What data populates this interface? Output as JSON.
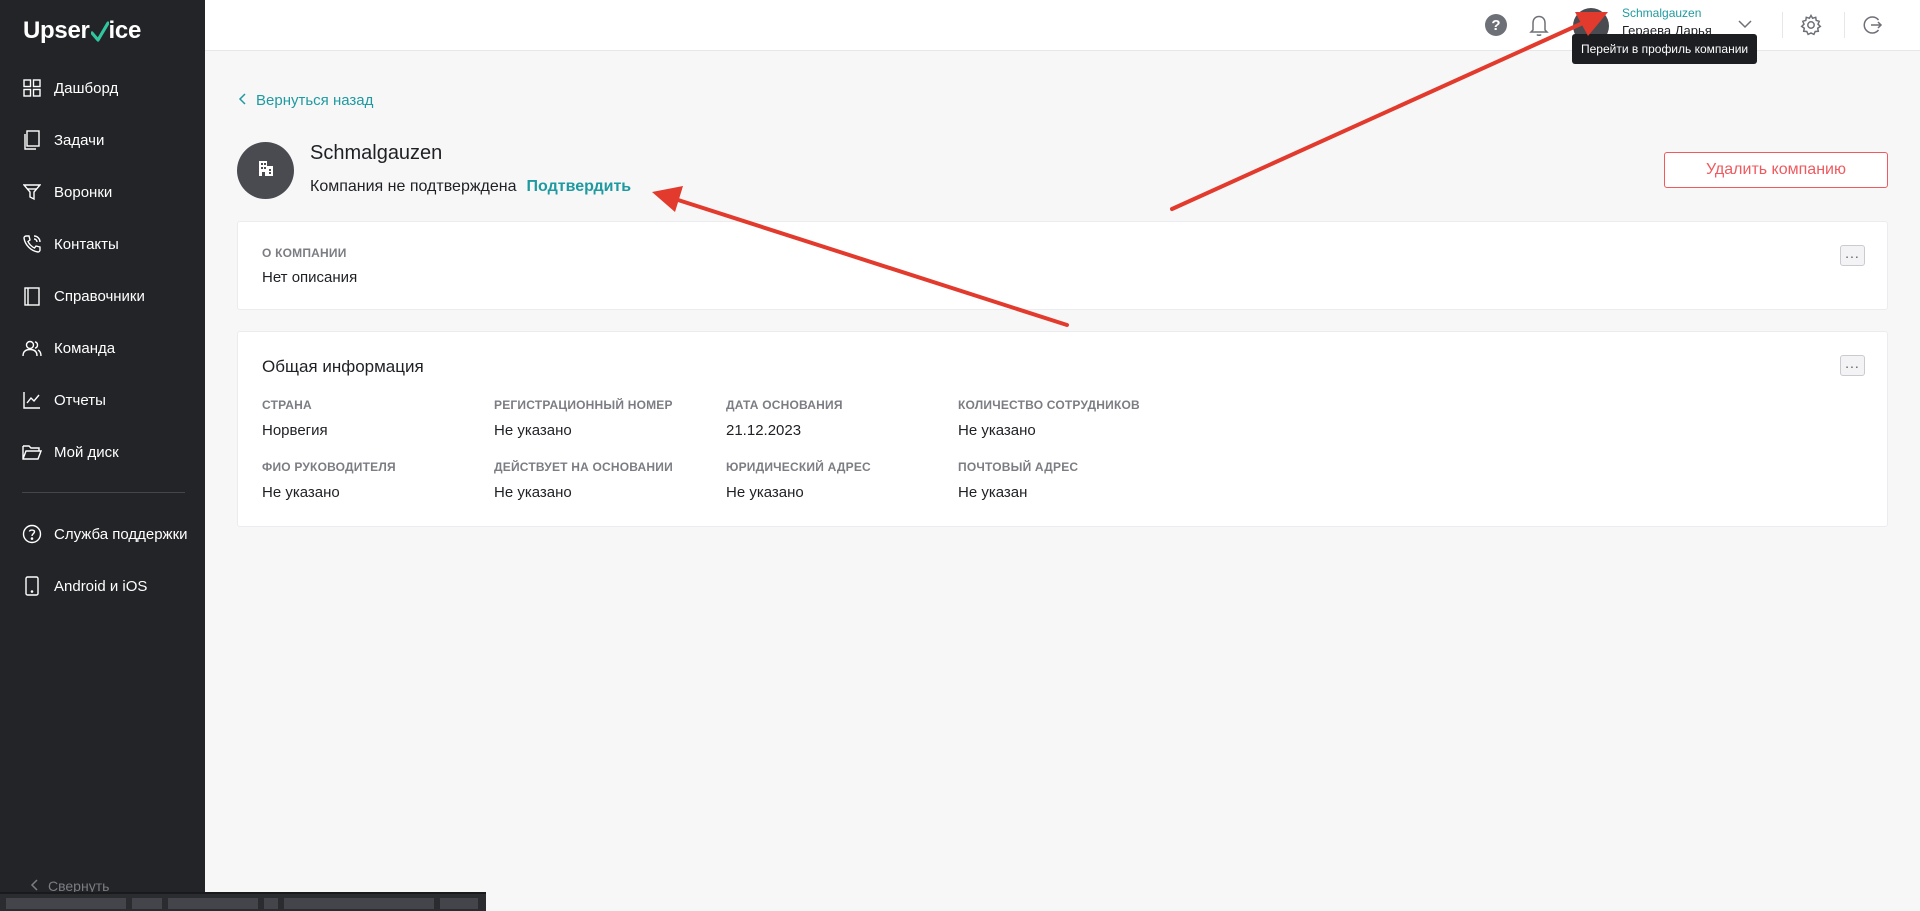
{
  "app": {
    "logo_text": "UpserVice"
  },
  "sidebar": {
    "items": [
      {
        "label": "Дашборд",
        "icon": "dashboard-icon"
      },
      {
        "label": "Задачи",
        "icon": "tasks-icon"
      },
      {
        "label": "Воронки",
        "icon": "funnel-icon"
      },
      {
        "label": "Контакты",
        "icon": "contacts-icon"
      },
      {
        "label": "Справочники",
        "icon": "book-icon"
      },
      {
        "label": "Команда",
        "icon": "team-icon"
      },
      {
        "label": "Отчеты",
        "icon": "chart-icon"
      },
      {
        "label": "Мой диск",
        "icon": "folder-icon"
      }
    ],
    "secondary": [
      {
        "label": "Служба поддержки",
        "icon": "help-circle-icon"
      },
      {
        "label": "Android и iOS",
        "icon": "phone-icon"
      }
    ],
    "collapse_label": "Свернуть"
  },
  "topbar": {
    "company_name": "Schmalgauzen",
    "user_name": "Гераева Дарья",
    "tooltip": "Перейти в профиль компании"
  },
  "page": {
    "back_label": "Вернуться назад",
    "company_title": "Schmalgauzen",
    "status_text": "Компания не подтверждена",
    "confirm_label": "Подтвердить",
    "delete_label": "Удалить компанию"
  },
  "about": {
    "caption": "О КОМПАНИИ",
    "value": "Нет описания"
  },
  "general": {
    "title": "Общая информация",
    "fields": [
      {
        "caption": "СТРАНА",
        "value": "Норвегия"
      },
      {
        "caption": "РЕГИСТРАЦИОННЫЙ НОМЕР",
        "value": "Не указано"
      },
      {
        "caption": "ДАТА ОСНОВАНИЯ",
        "value": "21.12.2023"
      },
      {
        "caption": "КОЛИЧЕСТВО СОТРУДНИКОВ",
        "value": "Не указано"
      },
      {
        "caption": "ФИО РУКОВОДИТЕЛЯ",
        "value": "Не указано"
      },
      {
        "caption": "ДЕЙСТВУЕТ НА ОСНОВАНИИ",
        "value": "Не указано"
      },
      {
        "caption": "ЮРИДИЧЕСКИЙ АДРЕС",
        "value": "Не указано"
      },
      {
        "caption": "ПОЧТОВЫЙ АДРЕС",
        "value": "Не указан"
      }
    ]
  },
  "colors": {
    "accent": "#1f9aa0",
    "danger": "#ef5a5f",
    "sidebar": "#232427",
    "annotation": "#e23b2e"
  }
}
